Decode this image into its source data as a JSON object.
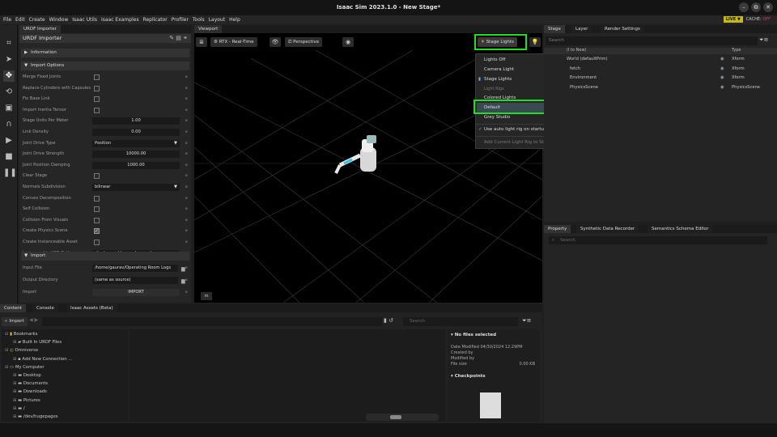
{
  "window": {
    "title": "Isaac Sim 2023.1.0 - New Stage*",
    "min": "–",
    "max": "⧉",
    "close": "✕"
  },
  "menubar": {
    "items": [
      "File",
      "Edit",
      "Create",
      "Window",
      "Isaac Utils",
      "Isaac Examples",
      "Replicator",
      "Profiler",
      "Tools",
      "Layout",
      "Help"
    ],
    "live": "LIVE",
    "live_caret": "▼",
    "cache_label": "CACHE:",
    "cache_state": "OFF"
  },
  "urdf_panel": {
    "tab": "URDF Importer",
    "title": "URDF Importer",
    "sections": {
      "information": "Information",
      "import_options": "Import Options",
      "import": "Import"
    },
    "options": [
      {
        "label": "Merge Fixed Joints",
        "kind": "check",
        "checked": false
      },
      {
        "label": "Replace Cylinders with Capsules",
        "kind": "check",
        "checked": false
      },
      {
        "label": "Fix Base Link",
        "kind": "check",
        "checked": false
      },
      {
        "label": "Import Inertia Tensor",
        "kind": "check",
        "checked": false
      },
      {
        "label": "Stage Units Per Meter",
        "kind": "field",
        "value": "1.00"
      },
      {
        "label": "Link Density",
        "kind": "field",
        "value": "0.00"
      },
      {
        "label": "Joint Drive Type",
        "kind": "select",
        "value": "Position"
      },
      {
        "label": "Joint Drive Strength",
        "kind": "field",
        "value": "10000.00"
      },
      {
        "label": "Joint Position Damping",
        "kind": "field",
        "value": "1000.00"
      },
      {
        "label": "Clear Stage",
        "kind": "check",
        "checked": false
      },
      {
        "label": "Normals Subdivision",
        "kind": "select",
        "value": "bilinear"
      },
      {
        "label": "Convex Decomposition",
        "kind": "check",
        "checked": false
      },
      {
        "label": "Self Collision",
        "kind": "check",
        "checked": false
      },
      {
        "label": "Collision From Visuals",
        "kind": "check",
        "checked": false
      },
      {
        "label": "Create Physics Scene",
        "kind": "check",
        "checked": true
      },
      {
        "label": "Create Instanceable Asset",
        "kind": "check",
        "checked": false
      },
      {
        "label": "Instanceable USD Path",
        "kind": "path",
        "value": "./instanceable_meshes.usd"
      }
    ],
    "import": [
      {
        "label": "Input File",
        "kind": "path",
        "value": "/home/gaurav/Operating Room Logs"
      },
      {
        "label": "Output Directory",
        "kind": "path",
        "value": "(same as source)"
      },
      {
        "label": "Import",
        "kind": "button",
        "value": "IMPORT"
      }
    ]
  },
  "viewport": {
    "tab": "Viewport",
    "render_mode": "RTX - Real-Time",
    "camera": "Perspective",
    "stage_lights": "Stage Lights",
    "units": "m"
  },
  "light_menu": {
    "items": [
      "Lights Off",
      "Camera Light",
      "Stage Lights"
    ],
    "section": "Light Rigs",
    "rigs": [
      "Colored Lights",
      "Default",
      "Grey Studio"
    ],
    "auto_rig": "Use auto light rig on startup",
    "add_current": "Add Current Light Rig to Stage",
    "add_plus": "+"
  },
  "stage": {
    "tabs": [
      "Stage",
      "Layer",
      "Render Settings"
    ],
    "search_placeholder": "Search",
    "col_name": "(I to New)",
    "col_type": "Type",
    "rows": [
      {
        "name": "World (defaultPrim)",
        "type": "Xform"
      },
      {
        "name": "fetch",
        "type": "Xform"
      },
      {
        "name": "Environment",
        "type": "Xform"
      },
      {
        "name": "PhysicsScene",
        "type": "PhysicsScene"
      }
    ]
  },
  "property": {
    "tabs": [
      "Property",
      "Synthetic Data Recorder",
      "Semantics Schema Editor"
    ],
    "search_placeholder": "Search"
  },
  "content": {
    "tabs": [
      "Content",
      "Console",
      "Isaac Assets (Beta)"
    ],
    "import_btn": "Import",
    "search_placeholder": "Search",
    "tree": [
      {
        "label": "Bookmarks",
        "indent": 0
      },
      {
        "label": "Built In URDF Files",
        "indent": 1
      },
      {
        "label": "Omniverse",
        "indent": 0
      },
      {
        "label": "Add New Connection ...",
        "indent": 1
      },
      {
        "label": "My Computer",
        "indent": 0
      },
      {
        "label": "Desktop",
        "indent": 1
      },
      {
        "label": "Documents",
        "indent": 1
      },
      {
        "label": "Downloads",
        "indent": 1
      },
      {
        "label": "Pictures",
        "indent": 1
      },
      {
        "label": "/",
        "indent": 1
      },
      {
        "label": "/dev/hugepages",
        "indent": 1
      }
    ],
    "details": {
      "no_files": "No files selected",
      "date_modified": "Date Modified 04/30/2024 12:29PM",
      "created_by": "Created by",
      "modified_by": "Modified by",
      "file_size_label": "File size",
      "file_size": "0.00 KB",
      "checkpoints": "Checkpoints"
    }
  },
  "colors": {
    "highlight": "#1fe01f",
    "accent": "#c8b81e"
  }
}
